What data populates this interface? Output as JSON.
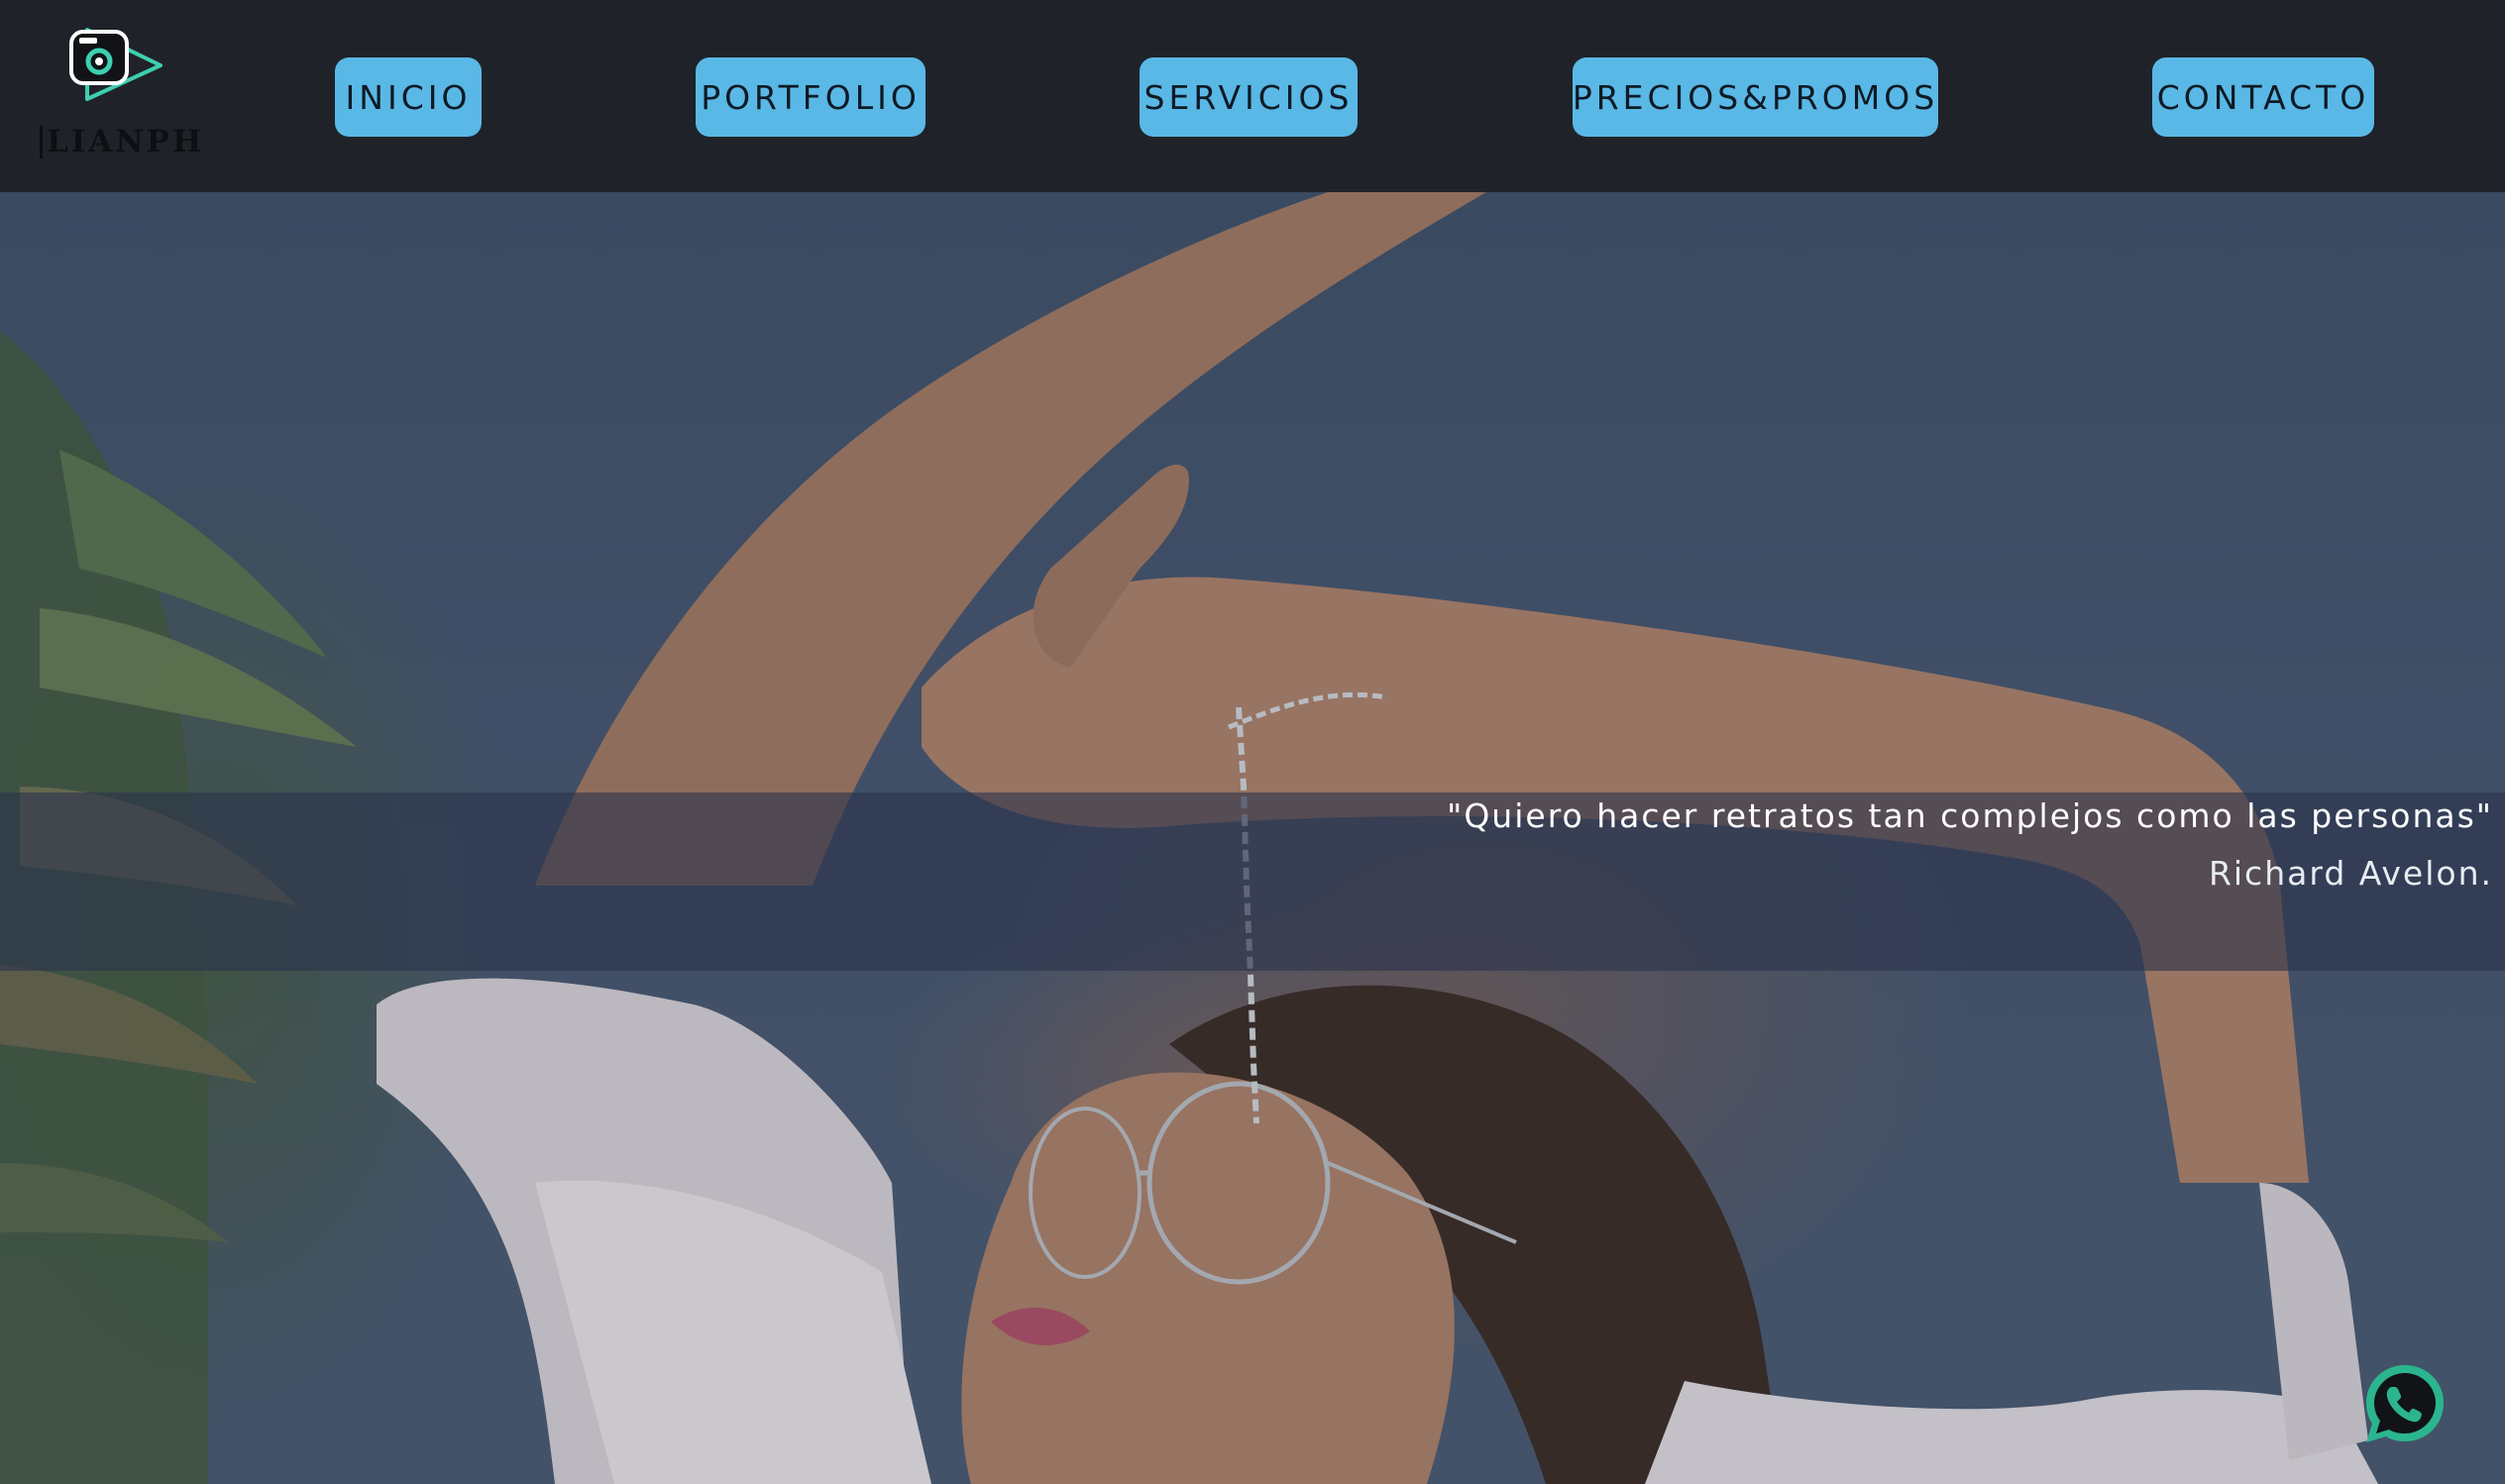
{
  "brand": {
    "logo_text": "LIANPH",
    "logo_icon": "camera-icon"
  },
  "nav": {
    "items": [
      {
        "label": "INICIO"
      },
      {
        "label": "PORTFOLIO"
      },
      {
        "label": "SERVICIOS"
      },
      {
        "label": "PRECIOS&PROMOS"
      },
      {
        "label": "CONTACTO"
      }
    ]
  },
  "hero": {
    "quote": "\"Quiero hacer retratos tan complejos como las personas\"",
    "author": "Richard Avelon."
  },
  "floating": {
    "whatsapp_icon": "whatsapp-icon"
  },
  "colors": {
    "header_bg": "#1f2329",
    "nav_button_bg": "#5ab8e6",
    "logo_accent": "#3ecfb0",
    "whatsapp_green": "#2bb58f"
  }
}
